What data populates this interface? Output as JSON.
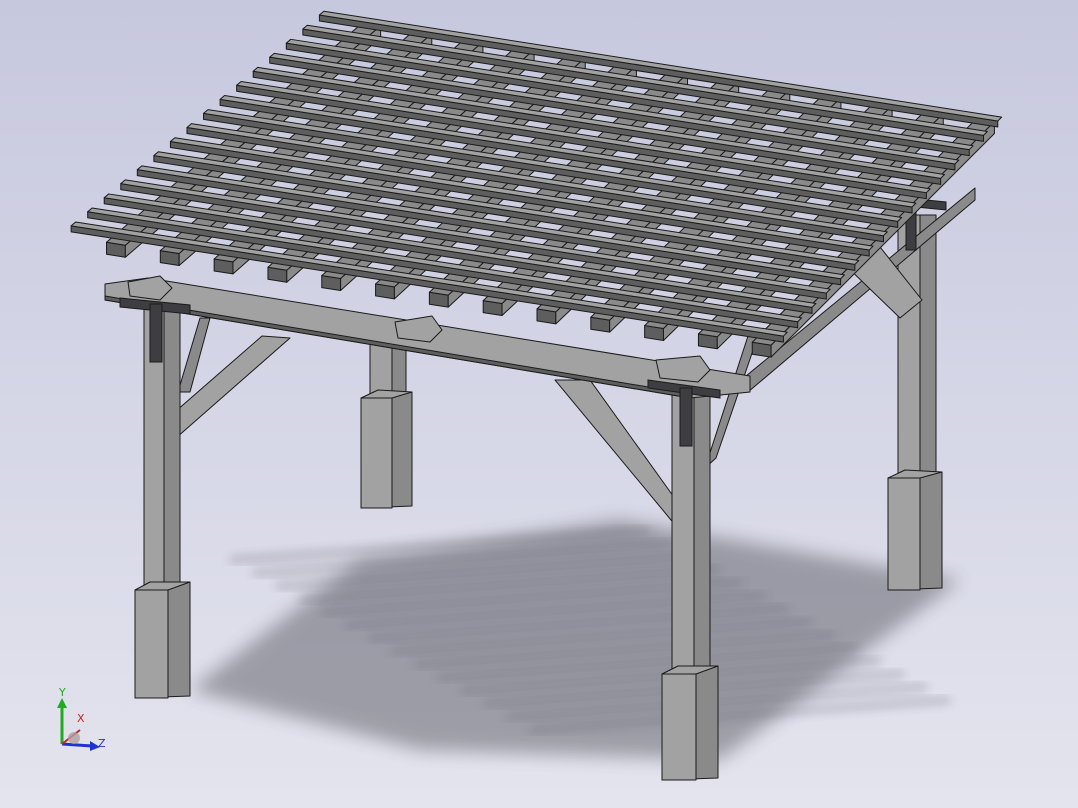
{
  "viewport": {
    "background_top": "#c6c8de",
    "background_bottom": "#e4e4ee"
  },
  "model": {
    "name": "pergola",
    "wood_light": "#a2a2a2",
    "wood_mid": "#8a8a8a",
    "wood_dark": "#5e5e5e",
    "edge_color": "#1a1a1a",
    "shadow_color": "#3c3c44"
  },
  "triad": {
    "x_label": "X",
    "y_label": "Y",
    "z_label": "Z",
    "x_color": "#cc2222",
    "y_color": "#22aa22",
    "z_color": "#2233cc"
  }
}
